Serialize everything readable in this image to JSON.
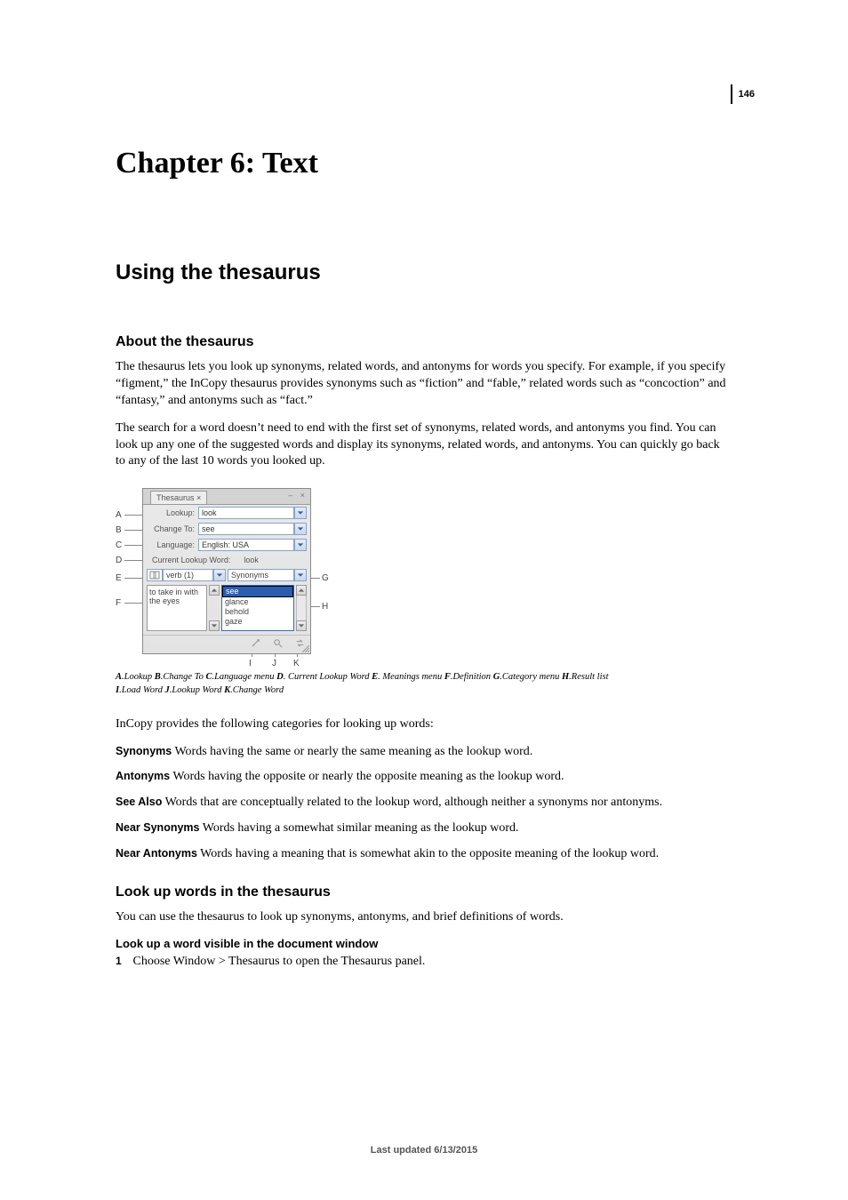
{
  "page_number": "146",
  "chapter_title": "Chapter 6: Text",
  "section_title": "Using the thesaurus",
  "about": {
    "heading": "About the thesaurus",
    "para1": "The thesaurus lets you look up synonyms, related words, and antonyms for words you specify. For example, if you specify “figment,” the InCopy thesaurus provides synonyms such as “fiction” and “fable,” related words such as “concoction” and “fantasy,” and antonyms such as “fact.”",
    "para2": "The search for a word doesn’t need to end with the first set of synonyms, related words, and antonyms you find. You can look up any one of the suggested words and display its synonyms, related words, and antonyms. You can quickly go back to any of the last 10 words you looked up."
  },
  "panel": {
    "tab": "Thesaurus ×",
    "lookup_label": "Lookup:",
    "lookup_value": "look",
    "changeto_label": "Change To:",
    "changeto_value": "see",
    "language_label": "Language:",
    "language_value": "English: USA",
    "current_label": "Current Lookup Word:",
    "current_value": "look",
    "meanings_value": "verb (1)",
    "category_value": "Synonyms",
    "definition": "to take in with the eyes",
    "results": [
      "see",
      "glance",
      "behold",
      "gaze"
    ]
  },
  "callouts": {
    "A": "A",
    "B": "B",
    "C": "C",
    "D": "D",
    "E": "E",
    "F": "F",
    "G": "G",
    "H": "H",
    "I": "I",
    "J": "J",
    "K": "K"
  },
  "caption_parts": {
    "A_label": "A",
    "A_text": ".Lookup ",
    "B_label": "B",
    "B_text": ".Change To ",
    "C_label": "C",
    "C_text": ".Language menu ",
    "D_label": "D",
    "D_text": ". Current Lookup Word ",
    "E_label": "E",
    "E_text": ". Meanings menu ",
    "F_label": "F",
    "F_text": ".Definition ",
    "G_label": "G",
    "G_text": ".Category menu ",
    "H_label": "H",
    "H_text": ".Result list ",
    "I_label": "I",
    "I_text": ".Load Word ",
    "J_label": "J",
    "J_text": ".Lookup Word ",
    "K_label": "K",
    "K_text": ".Change Word"
  },
  "intro_categories": "InCopy provides the following categories for looking up words:",
  "defs": {
    "syn_term": "Synonyms",
    "syn_text": "  Words having the same or nearly the same meaning as the lookup word.",
    "ant_term": "Antonyms",
    "ant_text": "  Words having the opposite or nearly the opposite meaning as the lookup word.",
    "see_term": "See Also",
    "see_text": "  Words that are conceptually related to the lookup word, although neither a synonyms nor antonyms.",
    "nsyn_term": "Near Synonyms",
    "nsyn_text": "  Words having a somewhat similar meaning as the lookup word.",
    "nant_term": "Near Antonyms",
    "nant_text": "  Words having a meaning that is somewhat akin to the opposite meaning of the lookup word."
  },
  "lookup": {
    "heading": "Look up words in the thesaurus",
    "para": "You can use the thesaurus to look up synonyms, antonyms, and brief definitions of words.",
    "proc_heading": "Look up a word visible in the document window",
    "step1_num": "1",
    "step1_text": "Choose Window > Thesaurus to open the Thesaurus panel."
  },
  "footer": "Last updated 6/13/2015"
}
